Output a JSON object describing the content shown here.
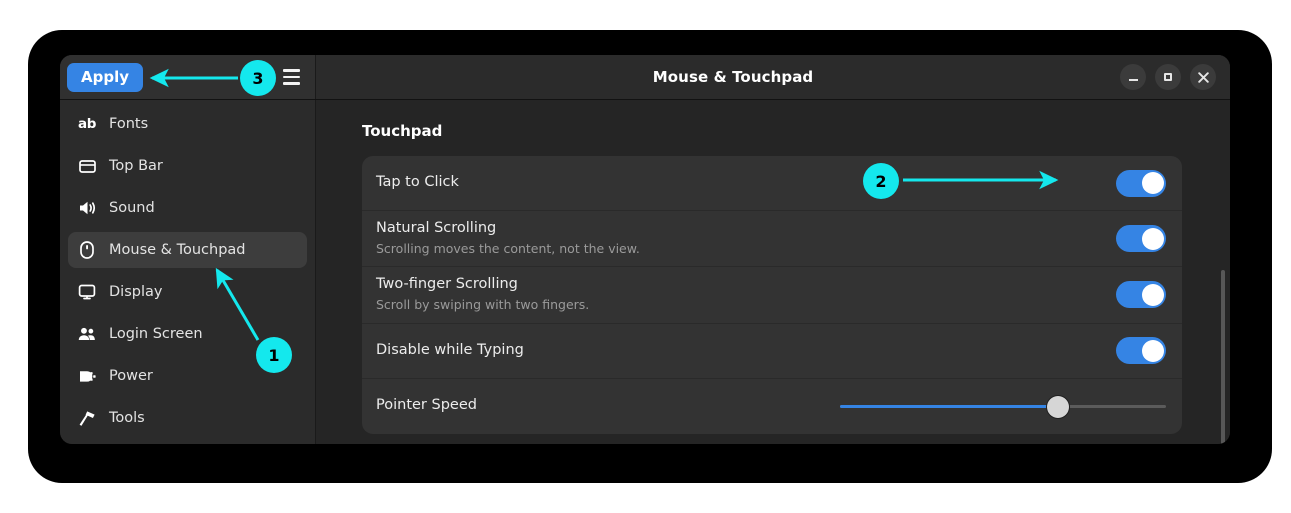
{
  "window": {
    "title": "Mouse & Touchpad",
    "controls": {
      "minimize": "minimize",
      "maximize": "maximize",
      "close": "✕"
    }
  },
  "headerbar": {
    "apply_label": "Apply",
    "menu_label": "menu"
  },
  "sidebar": {
    "items": [
      {
        "label": "Fonts",
        "icon": "ab-icon",
        "selected": false
      },
      {
        "label": "Top Bar",
        "icon": "top-bar-icon",
        "selected": false
      },
      {
        "label": "Sound",
        "icon": "speaker-icon",
        "selected": false
      },
      {
        "label": "Mouse & Touchpad",
        "icon": "mouse-icon",
        "selected": true
      },
      {
        "label": "Display",
        "icon": "display-icon",
        "selected": false
      },
      {
        "label": "Login Screen",
        "icon": "people-icon",
        "selected": false
      },
      {
        "label": "Power",
        "icon": "power-plug-icon",
        "selected": false
      },
      {
        "label": "Tools",
        "icon": "hammer-icon",
        "selected": false
      }
    ]
  },
  "main": {
    "section_title": "Touchpad",
    "rows": [
      {
        "title": "Tap to Click",
        "subtitle": "",
        "control": "toggle",
        "value": "on"
      },
      {
        "title": "Natural Scrolling",
        "subtitle": "Scrolling moves the content, not the view.",
        "control": "toggle",
        "value": "on"
      },
      {
        "title": "Two-finger Scrolling",
        "subtitle": "Scroll by swiping with two fingers.",
        "control": "toggle",
        "value": "on"
      },
      {
        "title": "Disable while Typing",
        "subtitle": "",
        "control": "toggle",
        "value": "on"
      },
      {
        "title": "Pointer Speed",
        "subtitle": "",
        "control": "slider",
        "value": "67"
      }
    ]
  },
  "annotations": {
    "markers": [
      {
        "label": "1",
        "target": "sidebar-item-mouse-touchpad"
      },
      {
        "label": "2",
        "target": "tap-to-click-toggle"
      },
      {
        "label": "3",
        "target": "apply-button"
      }
    ],
    "color": "#14e8ed"
  }
}
